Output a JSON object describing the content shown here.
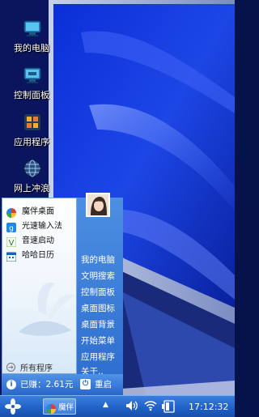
{
  "desktop": {
    "icons": [
      {
        "label": "我的电脑",
        "icon": "computer-icon"
      },
      {
        "label": "控制面板",
        "icon": "control-panel-icon"
      },
      {
        "label": "应用程序",
        "icon": "apps-icon"
      },
      {
        "label": "网上冲浪",
        "icon": "globe-icon"
      }
    ]
  },
  "start_menu": {
    "apps": [
      {
        "label": "魔伴桌面",
        "icon": "pinwheel-icon"
      },
      {
        "label": "光速输入法",
        "icon": "input-method-icon"
      },
      {
        "label": "音速启动",
        "icon": "quick-launch-icon"
      },
      {
        "label": "哈哈日历",
        "icon": "calendar-icon"
      }
    ],
    "all_programs": "所有程序",
    "links": [
      "我的电脑",
      "文明搜索",
      "控制面板",
      "桌面图标",
      "桌面背景",
      "开始菜单",
      "应用程序",
      "关于.."
    ],
    "earned_label": "已赚：2.61元",
    "restart_label": "重启"
  },
  "taskbar": {
    "app_label": "魔伴",
    "time": "17:12:32",
    "tray_up": "▲"
  },
  "colors": {
    "taskbar": "#1e5fc4",
    "menu_right": "#3c7ed9",
    "wallpaper": "#0a2ac9"
  }
}
